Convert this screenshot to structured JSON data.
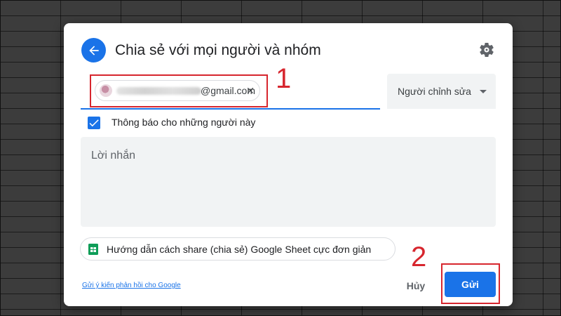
{
  "dialog": {
    "title": "Chia sẻ với mọi người và nhóm",
    "recipient": {
      "email_suffix": "@gmail.com"
    },
    "role_select": {
      "selected": "Người chỉnh sửa"
    },
    "notify": {
      "label": "Thông báo cho những người này",
      "checked": true
    },
    "message": {
      "placeholder": "Lời nhắn"
    },
    "link_chip": {
      "text": "Hướng dẫn cách share (chia sẻ) Google Sheet cực đơn giản"
    },
    "footer": {
      "feedback_link": "Gửi ý kiến phản hồi cho Google",
      "cancel_label": "Hủy",
      "send_label": "Gửi"
    }
  },
  "annotations": {
    "first": "1",
    "second": "2"
  },
  "colors": {
    "accent": "#1a73e8",
    "annotation": "#d7262e",
    "field_bg": "#f1f3f4"
  },
  "icons": {
    "back": "arrow-left-icon",
    "settings": "gear-icon",
    "remove": "close-icon",
    "dropdown": "caret-down-icon",
    "checkbox": "checkmark-icon",
    "sheets": "google-sheets-icon"
  }
}
